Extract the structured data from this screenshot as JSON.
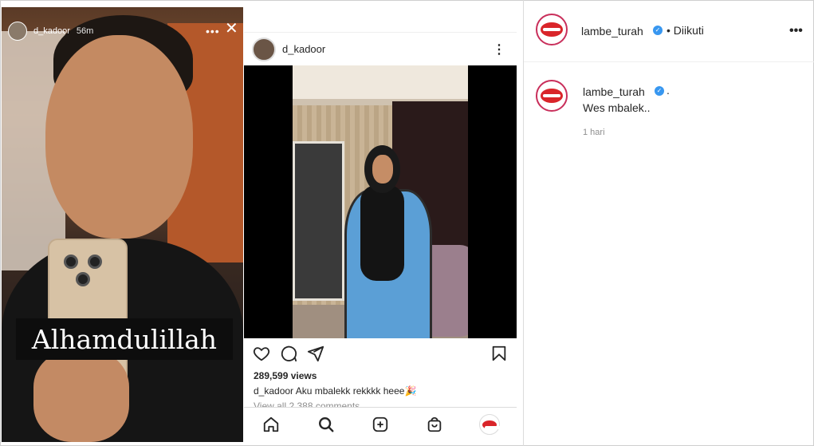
{
  "story": {
    "username": "d_kadoor",
    "time": "56m",
    "more_icon": "more-dots-icon",
    "close_icon": "close-icon",
    "caption": "Alhamdulillah"
  },
  "post": {
    "username": "d_kadoor",
    "views": "289,599 views",
    "caption_user": "d_kadoor",
    "caption_text": "Aku mbalekk rekkkk heee🎉",
    "comments_link": "View all 2,388 comments",
    "icons": [
      "heart-icon",
      "comment-icon",
      "share-icon",
      "bookmark-icon"
    ]
  },
  "bottom_nav": {
    "items": [
      "home-icon",
      "search-icon",
      "add-post-icon",
      "shop-icon",
      "profile-avatar"
    ]
  },
  "right_panel": {
    "username": "lambe_turah",
    "follow_status": "• Diikuti",
    "comment": {
      "username": "lambe_turah",
      "dot": ".",
      "text": "Wes mbalek..",
      "time": "1 hari"
    }
  },
  "colors": {
    "accent_verified": "#3897f0",
    "avatar_ring": "#c92f5b",
    "lips": "#d9252a"
  }
}
